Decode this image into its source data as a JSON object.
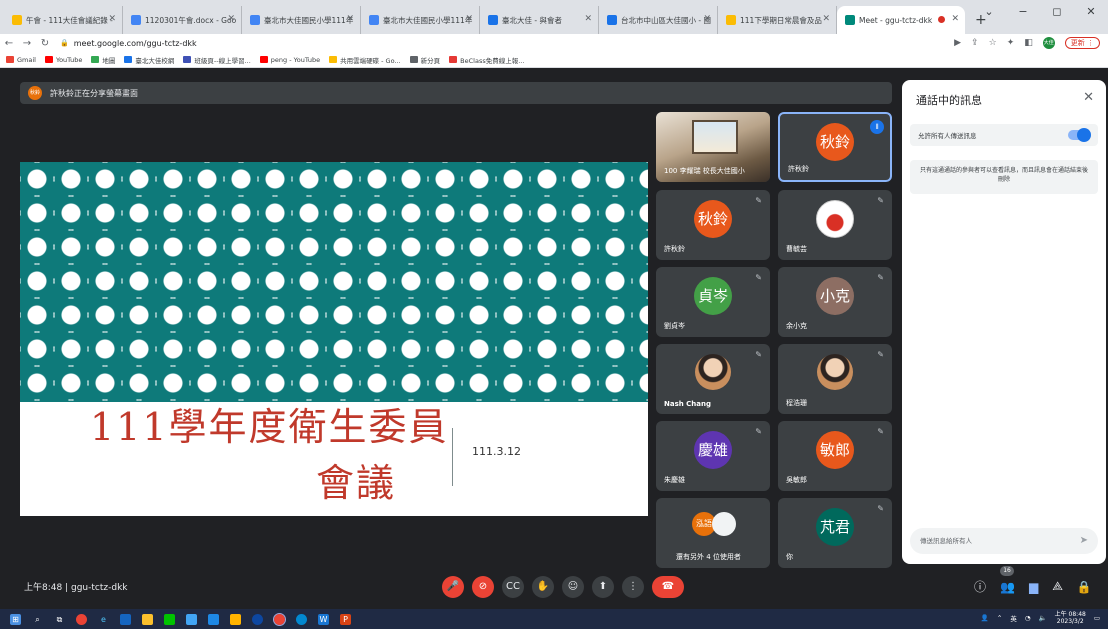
{
  "browser": {
    "tabs": [
      {
        "title": "午會 - 111大佳會議紀錄 -",
        "color": "#fbbc04"
      },
      {
        "title": "1120301午會.docx - Goo",
        "color": "#4285f4"
      },
      {
        "title": "臺北市大佳國民小學111年",
        "color": "#4285f4"
      },
      {
        "title": "臺北市大佳國民小學111年",
        "color": "#4285f4"
      },
      {
        "title": "臺北大佳 - 與會者",
        "color": "#1a73e8"
      },
      {
        "title": "台北市中山區大佳國小 - 國",
        "color": "#1a73e8"
      },
      {
        "title": "111下學期日常晨會及品",
        "color": "#fbbc04"
      },
      {
        "title": "Meet - ggu-tctz-dkk",
        "color": "#00897b"
      }
    ],
    "new_tab": "+",
    "window_controls": [
      "⌄",
      "−",
      "◻",
      "✕"
    ],
    "url": "meet.google.com/ggu-tctz-dkk",
    "profile_initials": "大佳",
    "update_label": "更新 ⋮",
    "bookmarks": [
      {
        "label": "Gmail",
        "color": "#ea4335"
      },
      {
        "label": "YouTube",
        "color": "#ff0000"
      },
      {
        "label": "地圖",
        "color": "#34a853"
      },
      {
        "label": "臺北大佳校網",
        "color": "#1a73e8"
      },
      {
        "label": "班級頁--線上學習...",
        "color": "#3f51b5"
      },
      {
        "label": "peng - YouTube",
        "color": "#ff0000"
      },
      {
        "label": "共用雲端硬碟 - Go...",
        "color": "#fbbc04"
      },
      {
        "label": "新分頁",
        "color": "#5f6368"
      },
      {
        "label": "BeClass免費線上報...",
        "color": "#e53935"
      }
    ]
  },
  "meet": {
    "presenting_avatar": "秋鈴",
    "presenting_text": "許秋鈴正在分享螢幕畫面",
    "slide": {
      "title_line1": "111學年度衛生委員",
      "title_line2": "會議",
      "date": "111.3.12"
    },
    "tiles": [
      {
        "name": "100 李耀瑞 校長大佳國小",
        "type": "room"
      },
      {
        "name": "許秋鈴",
        "avatar": "秋鈴",
        "color": "#e8581c",
        "active": true
      },
      {
        "name": "許秋鈴",
        "avatar": "秋鈴",
        "color": "#e8581c"
      },
      {
        "name": "曹毓芸",
        "type": "heart"
      },
      {
        "name": "劉貞岑",
        "avatar": "貞岑",
        "color": "#43a047"
      },
      {
        "name": "余小克",
        "avatar": "小克",
        "color": "#8d6e63"
      },
      {
        "name": "Nash Chang",
        "type": "photo"
      },
      {
        "name": "程浩珊",
        "type": "photo"
      },
      {
        "name": "朱慶雄",
        "avatar": "慶雄",
        "color": "#5e35b1"
      },
      {
        "name": "吳敏郎",
        "avatar": "敏郎",
        "color": "#e8581c"
      },
      {
        "name": "還有另外 4 位使用者",
        "type": "more",
        "mini": "泓語"
      },
      {
        "name": "你",
        "avatar": "芃君",
        "color": "#00695c"
      }
    ],
    "meeting_time": "上午8:48",
    "meeting_code": "ggu-tctz-dkk",
    "participant_count": "16"
  },
  "chat": {
    "title": "通話中的訊息",
    "allow_label": "允許所有人傳送訊息",
    "note": "只有這通通話的參與者可以查看訊息，而且訊息會在通話結束後刪除",
    "input_placeholder": "傳送訊息給所有人"
  },
  "taskbar": {
    "time": "上午 08:48",
    "date": "2023/3/2",
    "ime": "英"
  }
}
